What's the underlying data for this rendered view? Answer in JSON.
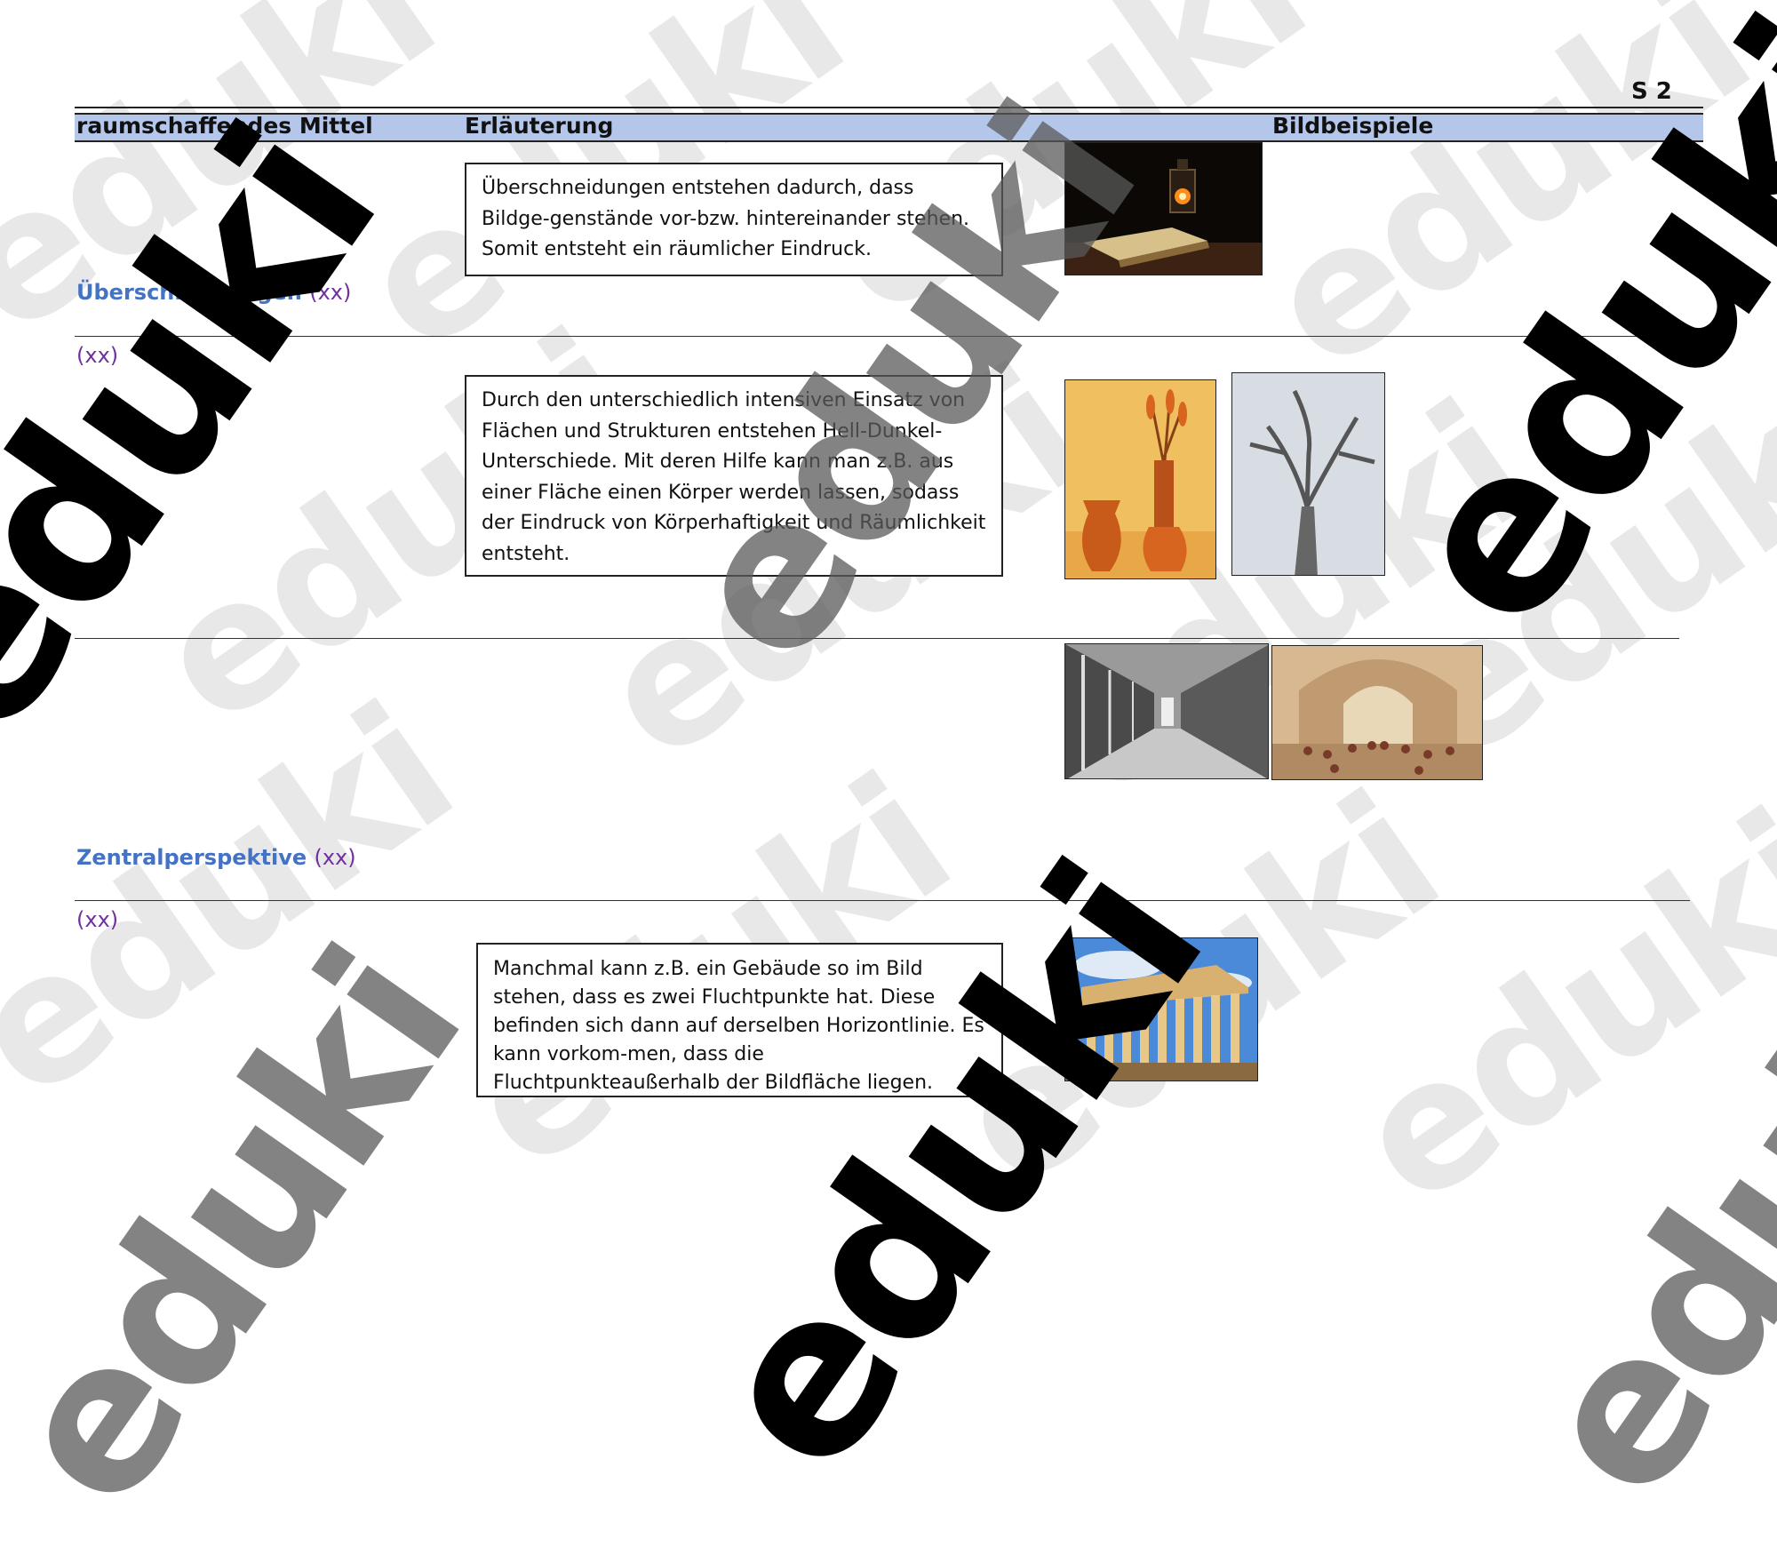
{
  "page_number": "S 2",
  "header": {
    "col1": "raumschaffendes Mittel",
    "col2": "Erläuterung",
    "col3": "Bildbeispiele"
  },
  "sections": [
    {
      "label": "Überschneidungen",
      "label_suffix": "(xx)",
      "second_line": "(xx)",
      "text": "Überschneidungen entstehen dadurch, dass Bildge-genstände vor-bzw. hintereinander stehen. Somit entsteht ein räumlicher Eindruck."
    },
    {
      "text": "Durch den unterschiedlich intensiven Einsatz von Flächen und Strukturen entstehen Hell-Dunkel-Unterschiede. Mit deren Hilfe kann man z.B. aus einer Fläche einen Körper werden lassen, sodass der Eindruck von Körperhaftigkeit und Räumlichkeit entsteht."
    },
    {
      "label": "Zentralperspektive",
      "label_suffix": "(xx)",
      "second_line": "(xx)"
    },
    {
      "text": "Manchmal kann z.B. ein Gebäude so im Bild stehen, dass es zwei Fluchtpunkte hat. Diese befinden sich dann auf derselben Horizontlinie. Es kann vorkom-men, dass die Fluchtpunkteaußerhalb der Bildfläche liegen."
    }
  ],
  "watermark": "eduki",
  "image_names": [
    "lantern-book-photo",
    "vase-painting",
    "tree-drawing",
    "colonnade-photo",
    "school-of-athens-fresco",
    "parthenon-photo"
  ]
}
